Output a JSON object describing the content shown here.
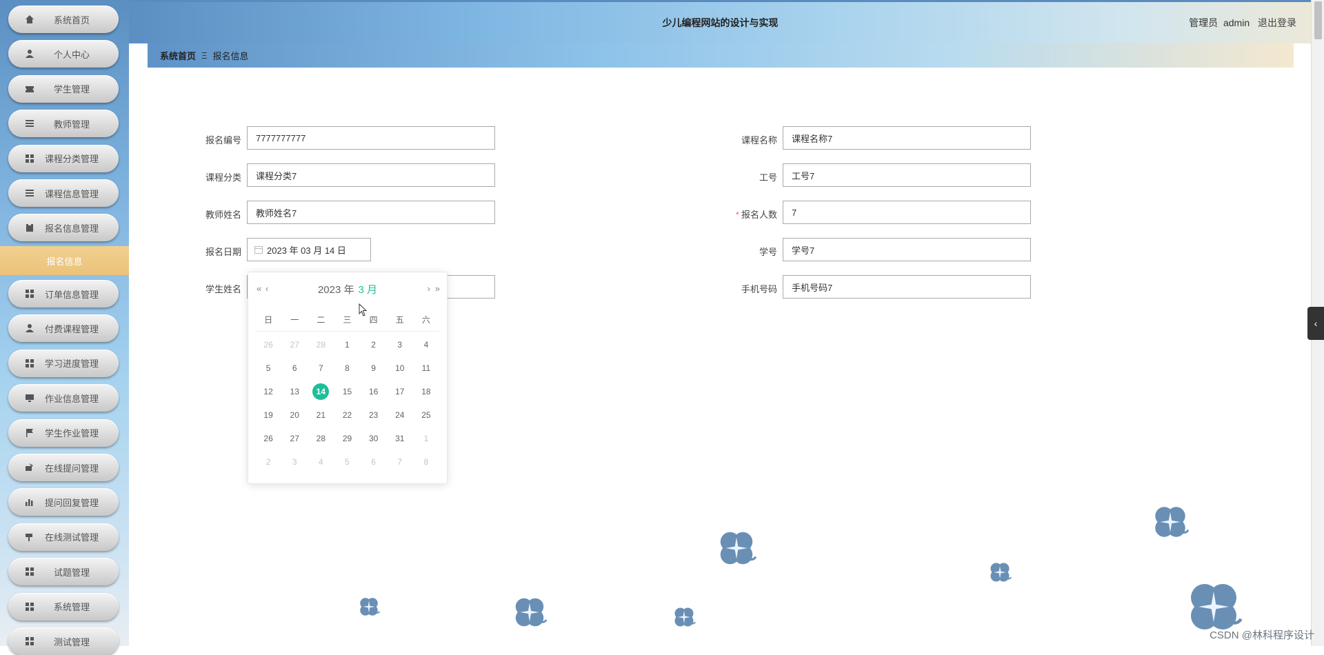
{
  "app_title": "少儿编程网站的设计与实现",
  "user": {
    "role": "管理员",
    "name": "admin",
    "logout_label": "退出登录"
  },
  "sidebar": {
    "items": [
      {
        "label": "系统首页",
        "icon": "home-icon"
      },
      {
        "label": "个人中心",
        "icon": "user-icon"
      },
      {
        "label": "学生管理",
        "icon": "ticket-icon"
      },
      {
        "label": "教师管理",
        "icon": "list-icon"
      },
      {
        "label": "课程分类管理",
        "icon": "grid-icon"
      },
      {
        "label": "课程信息管理",
        "icon": "list-icon"
      },
      {
        "label": "报名信息管理",
        "icon": "clipboard-icon"
      }
    ],
    "active_sub": "报名信息",
    "items_after": [
      {
        "label": "订单信息管理",
        "icon": "grid-icon"
      },
      {
        "label": "付费课程管理",
        "icon": "user-icon"
      },
      {
        "label": "学习进度管理",
        "icon": "grid-icon"
      },
      {
        "label": "作业信息管理",
        "icon": "monitor-icon"
      },
      {
        "label": "学生作业管理",
        "icon": "flag-icon"
      },
      {
        "label": "在线提问管理",
        "icon": "cup-icon"
      },
      {
        "label": "提问回复管理",
        "icon": "bar-chart-icon"
      },
      {
        "label": "在线测试管理",
        "icon": "hammer-icon"
      },
      {
        "label": "试题管理",
        "icon": "grid-icon"
      },
      {
        "label": "系统管理",
        "icon": "grid-icon"
      },
      {
        "label": "测试管理",
        "icon": "grid-icon"
      }
    ]
  },
  "breadcrumb": {
    "home": "系统首页",
    "separator": "Ξ",
    "current": "报名信息"
  },
  "form": {
    "left": [
      {
        "label": "报名编号",
        "value": "7777777777"
      },
      {
        "label": "课程分类",
        "value": "课程分类7"
      },
      {
        "label": "教师姓名",
        "value": "教师姓名7"
      },
      {
        "label": "报名日期",
        "value": "2023 年 03 月 14 日"
      },
      {
        "label": "学生姓名",
        "value": ""
      }
    ],
    "right": [
      {
        "label": "课程名称",
        "value": "课程名称7",
        "required": false
      },
      {
        "label": "工号",
        "value": "工号7",
        "required": false
      },
      {
        "label": "报名人数",
        "value": "7",
        "required": true
      },
      {
        "label": "学号",
        "value": "学号7",
        "required": false
      },
      {
        "label": "手机号码",
        "value": "手机号码7",
        "required": false
      }
    ],
    "required_mark": "*"
  },
  "calendar": {
    "year_label": "2023 年",
    "month_label": "3 月",
    "prev_year": "«",
    "prev_month": "‹",
    "next_month": "›",
    "next_year": "»",
    "weekdays": [
      "日",
      "一",
      "二",
      "三",
      "四",
      "五",
      "六"
    ],
    "weeks": [
      [
        {
          "d": "26",
          "dim": true
        },
        {
          "d": "27",
          "dim": true
        },
        {
          "d": "28",
          "dim": true
        },
        {
          "d": "1"
        },
        {
          "d": "2"
        },
        {
          "d": "3"
        },
        {
          "d": "4"
        }
      ],
      [
        {
          "d": "5"
        },
        {
          "d": "6"
        },
        {
          "d": "7"
        },
        {
          "d": "8"
        },
        {
          "d": "9"
        },
        {
          "d": "10"
        },
        {
          "d": "11"
        }
      ],
      [
        {
          "d": "12"
        },
        {
          "d": "13"
        },
        {
          "d": "14",
          "selected": true
        },
        {
          "d": "15"
        },
        {
          "d": "16"
        },
        {
          "d": "17"
        },
        {
          "d": "18"
        }
      ],
      [
        {
          "d": "19"
        },
        {
          "d": "20"
        },
        {
          "d": "21"
        },
        {
          "d": "22"
        },
        {
          "d": "23"
        },
        {
          "d": "24"
        },
        {
          "d": "25"
        }
      ],
      [
        {
          "d": "26"
        },
        {
          "d": "27"
        },
        {
          "d": "28"
        },
        {
          "d": "29"
        },
        {
          "d": "30"
        },
        {
          "d": "31"
        },
        {
          "d": "1",
          "dim": true
        }
      ],
      [
        {
          "d": "2",
          "dim": true
        },
        {
          "d": "3",
          "dim": true
        },
        {
          "d": "4",
          "dim": true
        },
        {
          "d": "5",
          "dim": true
        },
        {
          "d": "6",
          "dim": true
        },
        {
          "d": "7",
          "dim": true
        },
        {
          "d": "8",
          "dim": true
        }
      ]
    ]
  },
  "watermark": "CSDN @林科程序设计",
  "colors": {
    "accent": "#1dbf9a",
    "active_menu": "#ebc27a",
    "flower": "#6a8fb5"
  }
}
